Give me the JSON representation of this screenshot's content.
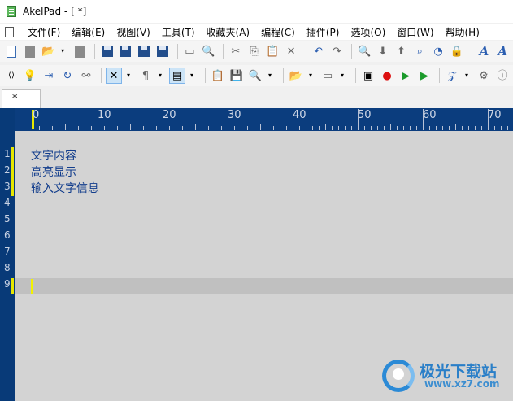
{
  "window": {
    "title": "AkelPad - [ *]"
  },
  "menu": [
    {
      "label": "文件(F)"
    },
    {
      "label": "编辑(E)"
    },
    {
      "label": "视图(V)"
    },
    {
      "label": "工具(T)"
    },
    {
      "label": "收藏夹(A)"
    },
    {
      "label": "编程(C)"
    },
    {
      "label": "插件(P)"
    },
    {
      "label": "选项(O)"
    },
    {
      "label": "窗口(W)"
    },
    {
      "label": "帮助(H)"
    }
  ],
  "toolbar_glyphs": {
    "open": "📂",
    "dropdown": "▾",
    "cut": "✂",
    "copy": "⎘",
    "paste": "📋",
    "delete": "✕",
    "undo": "↶",
    "redo": "↷",
    "find": "🔍",
    "down": "⬇",
    "up": "⬆",
    "find_replace": "⌕",
    "goto": "◔",
    "lock": "🔒",
    "font_a": "A",
    "tag": "⟨⟩",
    "bulb": "💡",
    "insert": "⇥",
    "refresh": "↻",
    "connect": "⚯",
    "wrap": "✕",
    "pilcrow": "¶",
    "layout": "▤",
    "clipboard": "📋",
    "save_copy": "💾",
    "zoom": "🔍",
    "folder": "📂",
    "field": "▭",
    "play_box": "▣",
    "record": "●",
    "play": "▶",
    "run": "▶",
    "script": "𝒵",
    "settings": "⚙",
    "info": "ⓘ"
  },
  "tab": {
    "label": "*"
  },
  "ruler": {
    "labels": [
      "0",
      "10",
      "20",
      "30",
      "40",
      "50",
      "60",
      "70"
    ]
  },
  "editor": {
    "line_numbers": [
      "1",
      "2",
      "3",
      "4",
      "5",
      "6",
      "7",
      "8",
      "9"
    ],
    "lines": [
      "文字内容",
      "高亮显示",
      "输入文字信息"
    ]
  },
  "watermark": {
    "title": "极光下载站",
    "url": "www.xz7.com"
  },
  "colors": {
    "editor_background": "#d3d3d3",
    "gutter_background": "#083a78",
    "text": "#123d8c",
    "caret": "#f2f200",
    "margin_line": "#e02020"
  }
}
